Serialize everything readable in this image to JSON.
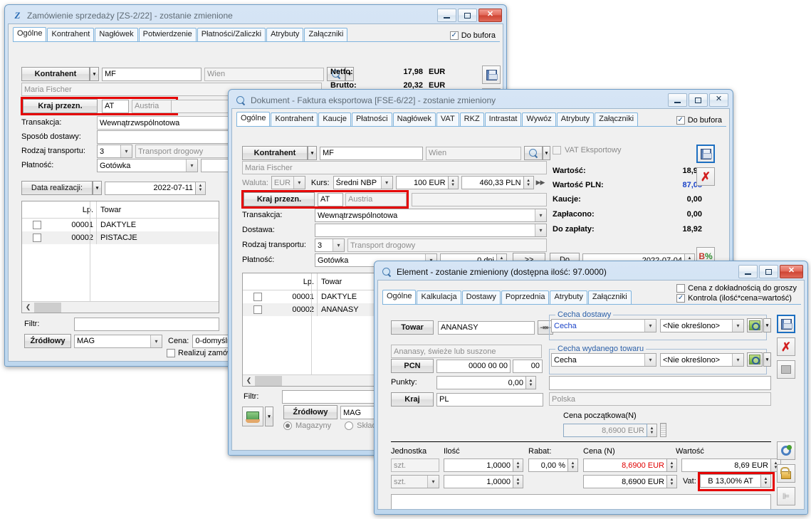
{
  "window1": {
    "title": "Zamówienie sprzedaży [ZS-2/22] - zostanie zmienione",
    "icon": "Z",
    "tabs": [
      {
        "label": "Ogólne",
        "selected": true
      },
      {
        "label": "Kontrahent",
        "selected": false
      },
      {
        "label": "Nagłówek",
        "selected": false
      },
      {
        "label": "Potwierdzenie",
        "selected": false
      },
      {
        "label": "Płatności/Zaliczki",
        "selected": false
      },
      {
        "label": "Atrybuty",
        "selected": false
      },
      {
        "label": "Załączniki",
        "selected": false
      }
    ],
    "do_bufora_label": "Do bufora",
    "do_bufora_checked": true,
    "kontrahent_button": "Kontrahent",
    "kontrahent_code": "MF",
    "kontrahent_city": "Wien",
    "kontrahent_name": "Maria Fischer",
    "kraj_button": "Kraj przezn.",
    "kraj_code": "AT",
    "kraj_name": "Austria",
    "fields": [
      {
        "label": "Transakcja:",
        "value": "Wewnątrzwspólnotowa"
      },
      {
        "label": "Sposób dostawy:",
        "value": ""
      },
      {
        "label": "Rodzaj transportu:",
        "value": "3",
        "value2": "Transport drogowy"
      },
      {
        "label": "Płatność:",
        "value": "Gotówka"
      }
    ],
    "data_realizacji_label": "Data realizacji:",
    "data_realizacji_value": "2022-07-11",
    "totals": [
      {
        "label": "Netto:",
        "value": "17,98",
        "currency": "EUR"
      },
      {
        "label": "Brutto:",
        "value": "20,32",
        "currency": "EUR"
      }
    ],
    "grid": {
      "columns": [
        "Lp.",
        "Towar"
      ],
      "rows": [
        {
          "lp": "00001",
          "towar": "DAKTYLE"
        },
        {
          "lp": "00002",
          "towar": "PISTACJE"
        }
      ]
    },
    "filtr_label": "Filtr:",
    "filtr_value": "",
    "zrodlowy_button": "Źródłowy",
    "magazyn_value": "MAG",
    "cena_label": "Cena:",
    "cena_value": "0-domyślna",
    "realizuj_label": "Realizuj zamówienie",
    "realizuj_checked": false
  },
  "window2": {
    "title": "Dokument - Faktura eksportowa [FSE-6/22]  - zostanie zmieniony",
    "icon": "search-icon",
    "tabs": [
      {
        "label": "Ogólne",
        "selected": true
      },
      {
        "label": "Kontrahent",
        "selected": false
      },
      {
        "label": "Kaucje",
        "selected": false
      },
      {
        "label": "Płatności",
        "selected": false
      },
      {
        "label": "Nagłówek",
        "selected": false
      },
      {
        "label": "VAT",
        "selected": false
      },
      {
        "label": "RKZ",
        "selected": false
      },
      {
        "label": "Intrastat",
        "selected": false
      },
      {
        "label": "Wywóz",
        "selected": false
      },
      {
        "label": "Atrybuty",
        "selected": false
      },
      {
        "label": "Załączniki",
        "selected": false
      }
    ],
    "do_bufora_label": "Do bufora",
    "do_bufora_checked": true,
    "kontrahent_button": "Kontrahent",
    "kontrahent_code": "MF",
    "kontrahent_city": "Wien",
    "kontrahent_name": "Maria Fischer",
    "vat_eksportowy_label": "VAT Eksportowy",
    "vat_eksportowy_checked": false,
    "waluta_label": "Waluta:",
    "waluta_value": "EUR",
    "kurs_label": "Kurs:",
    "kurs_type": "Średni NBP",
    "kurs_amount": "100 EUR",
    "kurs_pln": "460,33 PLN",
    "kraj_button": "Kraj przezn.",
    "kraj_code": "AT",
    "kraj_name": "Austria",
    "transakcja_label": "Transakcja:",
    "transakcja_value": "Wewnątrzwspólnotowa",
    "dostawa_label": "Dostawa:",
    "dostawa_value": "",
    "rodzaj_transportu_label": "Rodzaj transportu:",
    "rodzaj_transportu_code": "3",
    "rodzaj_transportu_value": "Transport drogowy",
    "platnosc_label": "Płatność:",
    "platnosc_value": "Gotówka",
    "platnosc_dni": "0 dni",
    "platnosc_more": ">>",
    "platnosc_do": "Do",
    "platnosc_date": "2022-07-04",
    "totals": [
      {
        "label": "Wartość:",
        "value": "18,92",
        "accent": false
      },
      {
        "label": "Wartość PLN:",
        "value": "87,08",
        "accent": true
      },
      {
        "label": "Kaucje:",
        "value": "0,00",
        "accent": false
      },
      {
        "label": "Zapłacono:",
        "value": "0,00",
        "accent": false
      },
      {
        "label": "Do zapłaty:",
        "value": "18,92",
        "accent": false
      }
    ],
    "grid": {
      "columns": [
        "Lp.",
        "Towar"
      ],
      "rows": [
        {
          "lp": "00001",
          "towar": "DAKTYLE"
        },
        {
          "lp": "00002",
          "towar": "ANANASY"
        }
      ]
    },
    "filtr_label": "Filtr:",
    "filtr_value": "",
    "zrodlowy_button": "Źródłowy",
    "magazyn_value": "MAG",
    "magazyny_label": "Magazyny",
    "magazyny_selected": true,
    "sklady_label": "Składy",
    "sklady_selected": false
  },
  "window3": {
    "title": "Element - zostanie zmieniony (dostępna ilość: 97.0000)",
    "icon": "search-icon",
    "tabs": [
      {
        "label": "Ogólne",
        "selected": true
      },
      {
        "label": "Kalkulacja",
        "selected": false
      },
      {
        "label": "Dostawy",
        "selected": false
      },
      {
        "label": "Poprzednia",
        "selected": false
      },
      {
        "label": "Atrybuty",
        "selected": false
      },
      {
        "label": "Załączniki",
        "selected": false
      }
    ],
    "opt_groszy_label": "Cena z dokładnością do groszy",
    "opt_groszy_checked": false,
    "opt_kontrola_label": "Kontrola (ilość*cena=wartość)",
    "opt_kontrola_checked": true,
    "towar_button": "Towar",
    "towar_value": "ANANASY",
    "towar_desc": "Ananasy, świeże lub suszone",
    "pcn_button": "PCN",
    "pcn_value": "0000 00 00",
    "pcn_suffix": "00",
    "punkty_label": "Punkty:",
    "punkty_value": "0,00",
    "kraj_button": "Kraj",
    "kraj_code": "PL",
    "kraj_name": "Polska",
    "cecha_dostawy_title": "Cecha dostawy",
    "cecha_dostawy_name": "Cecha",
    "cecha_dostawy_value": "<Nie określono>",
    "cecha_wydanego_title": "Cecha wydanego towaru",
    "cecha_wydanego_name": "Cecha",
    "cecha_wydanego_value": "<Nie określono>",
    "notes_value": "",
    "cena_poczatkowa_label": "Cena początkowa(N)",
    "cena_poczatkowa_value": "8,6900 EUR",
    "columns": {
      "jednostka": "Jednostka",
      "ilosc": "Ilość",
      "rabat": "Rabat:",
      "cena": "Cena (N)",
      "wartosc": "Wartość"
    },
    "row1": {
      "jednostka": "szt.",
      "ilosc": "1,0000",
      "rabat": "0,00 %",
      "cena": "8,6900 EUR",
      "wartosc": "8,69 EUR"
    },
    "row2": {
      "jednostka": "szt.",
      "ilosc": "1,0000",
      "cena": "8,6900 EUR",
      "vat_label": "Vat:",
      "vat_value": "B 13,00% AT"
    }
  },
  "colors": {
    "accent_blue": "#1a43c8",
    "price_red": "#e00000",
    "highlight_red": "#e50000",
    "group_title": "#2a5fa8",
    "title_text_inactive": "#5f6b75"
  }
}
